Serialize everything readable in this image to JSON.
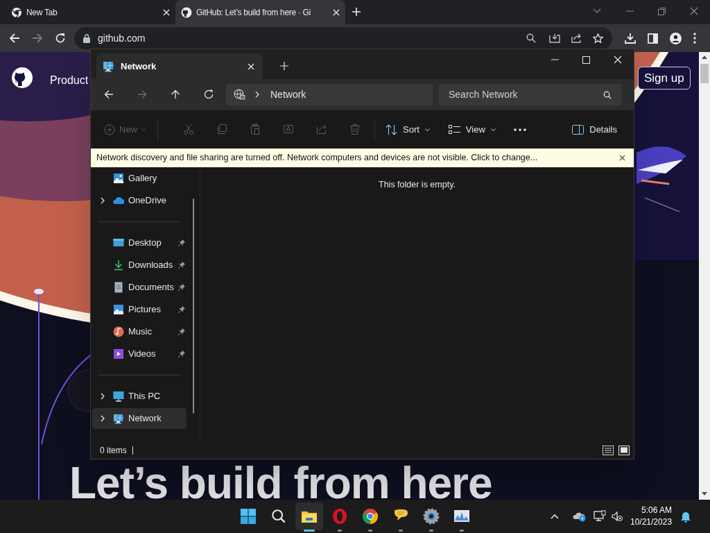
{
  "browser": {
    "tabs": [
      {
        "title": "New Tab",
        "selected": false
      },
      {
        "title": "GitHub: Let’s build from here · Gi",
        "selected": true
      }
    ],
    "address": "github.com"
  },
  "page": {
    "nav_item": "Product",
    "signup": "Sign up",
    "headline": "Let’s build from here"
  },
  "explorer": {
    "tab_title": "Network",
    "breadcrumb": "Network",
    "search": {
      "placeholder": "Search Network"
    },
    "toolbar": {
      "new": {
        "label": "New",
        "disabled": true
      },
      "cut": {
        "disabled": true
      },
      "copy": {
        "disabled": true
      },
      "paste": {
        "disabled": true
      },
      "rename": {
        "disabled": true
      },
      "share": {
        "disabled": true
      },
      "delete": {
        "disabled": true
      },
      "sort": {
        "label": "Sort"
      },
      "view": {
        "label": "View"
      },
      "details": {
        "label": "Details"
      }
    },
    "banner": "Network discovery and file sharing are turned off. Network computers and devices are not visible. Click to change...",
    "sidebar": {
      "groups": [
        [
          {
            "label": "Gallery",
            "expandable": false,
            "pinned": false,
            "selected": false
          },
          {
            "label": "OneDrive",
            "expandable": true,
            "pinned": false,
            "selected": false
          }
        ],
        [
          {
            "label": "Desktop",
            "expandable": false,
            "pinned": true,
            "selected": false
          },
          {
            "label": "Downloads",
            "expandable": false,
            "pinned": true,
            "selected": false
          },
          {
            "label": "Documents",
            "expandable": false,
            "pinned": true,
            "selected": false
          },
          {
            "label": "Pictures",
            "expandable": false,
            "pinned": true,
            "selected": false
          },
          {
            "label": "Music",
            "expandable": false,
            "pinned": true,
            "selected": false
          },
          {
            "label": "Videos",
            "expandable": false,
            "pinned": true,
            "selected": false
          }
        ],
        [
          {
            "label": "This PC",
            "expandable": true,
            "pinned": false,
            "selected": false
          },
          {
            "label": "Network",
            "expandable": true,
            "pinned": false,
            "selected": true
          }
        ]
      ]
    },
    "empty_message": "This folder is empty.",
    "status": "0 items"
  },
  "taskbar": {
    "apps": [
      {
        "running": true,
        "selected": true
      },
      {
        "running": true,
        "selected": false
      },
      {
        "running": true,
        "selected": false
      },
      {
        "running": true,
        "selected": false
      },
      {
        "running": true,
        "selected": false
      },
      {
        "running": true,
        "selected": false
      }
    ],
    "time": "5:06 AM",
    "date": "10/21/2023"
  }
}
